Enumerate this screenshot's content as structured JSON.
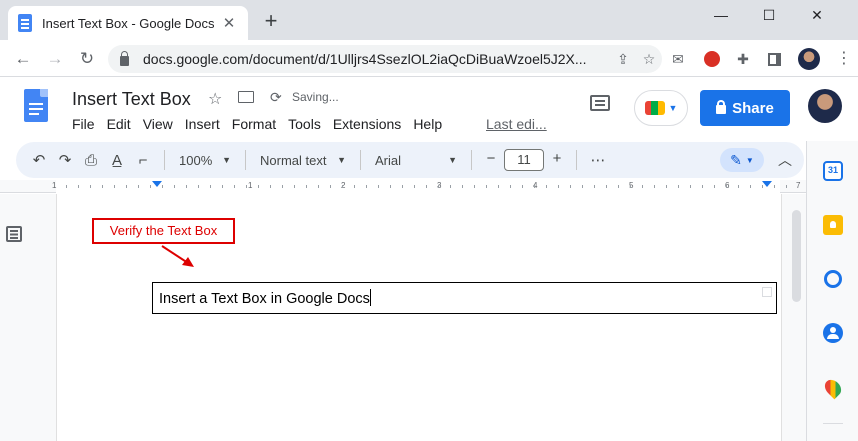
{
  "browser": {
    "tab_title": "Insert Text Box - Google Docs",
    "tab_close": "✕",
    "new_tab": "+",
    "url": "docs.google.com/document/d/1Ulljrs4SsezlOL2iaQcDiBuaWzoel5J2X...",
    "window_controls": {
      "minimize": "—",
      "maximize": "☐",
      "close": "✕"
    },
    "nav": {
      "back": "←",
      "forward": "→",
      "reload": "↻"
    }
  },
  "docs": {
    "title": "Insert Text Box",
    "saving": "Saving...",
    "menu": [
      "File",
      "Edit",
      "View",
      "Insert",
      "Format",
      "Tools",
      "Extensions",
      "Help"
    ],
    "last_edit": "Last edi...",
    "share_label": "Share"
  },
  "toolbar": {
    "zoom": "100%",
    "style": "Normal text",
    "font": "Arial",
    "font_size": "11",
    "decrease": "−",
    "increase": "+",
    "more": "⋯"
  },
  "ruler": {
    "labels": [
      "1",
      "1",
      "2",
      "3",
      "4",
      "5",
      "6",
      "7"
    ]
  },
  "document": {
    "text_box_content": "Insert a Text Box in Google Docs"
  },
  "annotation": {
    "label": "Verify the Text Box"
  },
  "side_panel": {
    "calendar_day": "31"
  },
  "colors": {
    "accent": "#1a73e8",
    "annotation": "#dd0000",
    "toolbar_bg": "#edf2fa"
  }
}
